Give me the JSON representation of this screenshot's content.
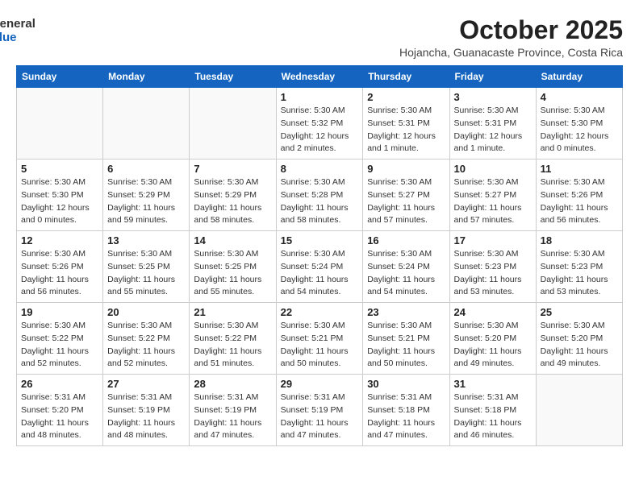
{
  "logo": {
    "general": "General",
    "blue": "Blue"
  },
  "header": {
    "month": "October 2025",
    "location": "Hojancha, Guanacaste Province, Costa Rica"
  },
  "weekdays": [
    "Sunday",
    "Monday",
    "Tuesday",
    "Wednesday",
    "Thursday",
    "Friday",
    "Saturday"
  ],
  "weeks": [
    [
      {
        "day": "",
        "sunrise": "",
        "sunset": "",
        "daylight": ""
      },
      {
        "day": "",
        "sunrise": "",
        "sunset": "",
        "daylight": ""
      },
      {
        "day": "",
        "sunrise": "",
        "sunset": "",
        "daylight": ""
      },
      {
        "day": "1",
        "sunrise": "Sunrise: 5:30 AM",
        "sunset": "Sunset: 5:32 PM",
        "daylight": "Daylight: 12 hours and 2 minutes."
      },
      {
        "day": "2",
        "sunrise": "Sunrise: 5:30 AM",
        "sunset": "Sunset: 5:31 PM",
        "daylight": "Daylight: 12 hours and 1 minute."
      },
      {
        "day": "3",
        "sunrise": "Sunrise: 5:30 AM",
        "sunset": "Sunset: 5:31 PM",
        "daylight": "Daylight: 12 hours and 1 minute."
      },
      {
        "day": "4",
        "sunrise": "Sunrise: 5:30 AM",
        "sunset": "Sunset: 5:30 PM",
        "daylight": "Daylight: 12 hours and 0 minutes."
      }
    ],
    [
      {
        "day": "5",
        "sunrise": "Sunrise: 5:30 AM",
        "sunset": "Sunset: 5:30 PM",
        "daylight": "Daylight: 12 hours and 0 minutes."
      },
      {
        "day": "6",
        "sunrise": "Sunrise: 5:30 AM",
        "sunset": "Sunset: 5:29 PM",
        "daylight": "Daylight: 11 hours and 59 minutes."
      },
      {
        "day": "7",
        "sunrise": "Sunrise: 5:30 AM",
        "sunset": "Sunset: 5:29 PM",
        "daylight": "Daylight: 11 hours and 58 minutes."
      },
      {
        "day": "8",
        "sunrise": "Sunrise: 5:30 AM",
        "sunset": "Sunset: 5:28 PM",
        "daylight": "Daylight: 11 hours and 58 minutes."
      },
      {
        "day": "9",
        "sunrise": "Sunrise: 5:30 AM",
        "sunset": "Sunset: 5:27 PM",
        "daylight": "Daylight: 11 hours and 57 minutes."
      },
      {
        "day": "10",
        "sunrise": "Sunrise: 5:30 AM",
        "sunset": "Sunset: 5:27 PM",
        "daylight": "Daylight: 11 hours and 57 minutes."
      },
      {
        "day": "11",
        "sunrise": "Sunrise: 5:30 AM",
        "sunset": "Sunset: 5:26 PM",
        "daylight": "Daylight: 11 hours and 56 minutes."
      }
    ],
    [
      {
        "day": "12",
        "sunrise": "Sunrise: 5:30 AM",
        "sunset": "Sunset: 5:26 PM",
        "daylight": "Daylight: 11 hours and 56 minutes."
      },
      {
        "day": "13",
        "sunrise": "Sunrise: 5:30 AM",
        "sunset": "Sunset: 5:25 PM",
        "daylight": "Daylight: 11 hours and 55 minutes."
      },
      {
        "day": "14",
        "sunrise": "Sunrise: 5:30 AM",
        "sunset": "Sunset: 5:25 PM",
        "daylight": "Daylight: 11 hours and 55 minutes."
      },
      {
        "day": "15",
        "sunrise": "Sunrise: 5:30 AM",
        "sunset": "Sunset: 5:24 PM",
        "daylight": "Daylight: 11 hours and 54 minutes."
      },
      {
        "day": "16",
        "sunrise": "Sunrise: 5:30 AM",
        "sunset": "Sunset: 5:24 PM",
        "daylight": "Daylight: 11 hours and 54 minutes."
      },
      {
        "day": "17",
        "sunrise": "Sunrise: 5:30 AM",
        "sunset": "Sunset: 5:23 PM",
        "daylight": "Daylight: 11 hours and 53 minutes."
      },
      {
        "day": "18",
        "sunrise": "Sunrise: 5:30 AM",
        "sunset": "Sunset: 5:23 PM",
        "daylight": "Daylight: 11 hours and 53 minutes."
      }
    ],
    [
      {
        "day": "19",
        "sunrise": "Sunrise: 5:30 AM",
        "sunset": "Sunset: 5:22 PM",
        "daylight": "Daylight: 11 hours and 52 minutes."
      },
      {
        "day": "20",
        "sunrise": "Sunrise: 5:30 AM",
        "sunset": "Sunset: 5:22 PM",
        "daylight": "Daylight: 11 hours and 52 minutes."
      },
      {
        "day": "21",
        "sunrise": "Sunrise: 5:30 AM",
        "sunset": "Sunset: 5:22 PM",
        "daylight": "Daylight: 11 hours and 51 minutes."
      },
      {
        "day": "22",
        "sunrise": "Sunrise: 5:30 AM",
        "sunset": "Sunset: 5:21 PM",
        "daylight": "Daylight: 11 hours and 50 minutes."
      },
      {
        "day": "23",
        "sunrise": "Sunrise: 5:30 AM",
        "sunset": "Sunset: 5:21 PM",
        "daylight": "Daylight: 11 hours and 50 minutes."
      },
      {
        "day": "24",
        "sunrise": "Sunrise: 5:30 AM",
        "sunset": "Sunset: 5:20 PM",
        "daylight": "Daylight: 11 hours and 49 minutes."
      },
      {
        "day": "25",
        "sunrise": "Sunrise: 5:30 AM",
        "sunset": "Sunset: 5:20 PM",
        "daylight": "Daylight: 11 hours and 49 minutes."
      }
    ],
    [
      {
        "day": "26",
        "sunrise": "Sunrise: 5:31 AM",
        "sunset": "Sunset: 5:20 PM",
        "daylight": "Daylight: 11 hours and 48 minutes."
      },
      {
        "day": "27",
        "sunrise": "Sunrise: 5:31 AM",
        "sunset": "Sunset: 5:19 PM",
        "daylight": "Daylight: 11 hours and 48 minutes."
      },
      {
        "day": "28",
        "sunrise": "Sunrise: 5:31 AM",
        "sunset": "Sunset: 5:19 PM",
        "daylight": "Daylight: 11 hours and 47 minutes."
      },
      {
        "day": "29",
        "sunrise": "Sunrise: 5:31 AM",
        "sunset": "Sunset: 5:19 PM",
        "daylight": "Daylight: 11 hours and 47 minutes."
      },
      {
        "day": "30",
        "sunrise": "Sunrise: 5:31 AM",
        "sunset": "Sunset: 5:18 PM",
        "daylight": "Daylight: 11 hours and 47 minutes."
      },
      {
        "day": "31",
        "sunrise": "Sunrise: 5:31 AM",
        "sunset": "Sunset: 5:18 PM",
        "daylight": "Daylight: 11 hours and 46 minutes."
      },
      {
        "day": "",
        "sunrise": "",
        "sunset": "",
        "daylight": ""
      }
    ]
  ]
}
